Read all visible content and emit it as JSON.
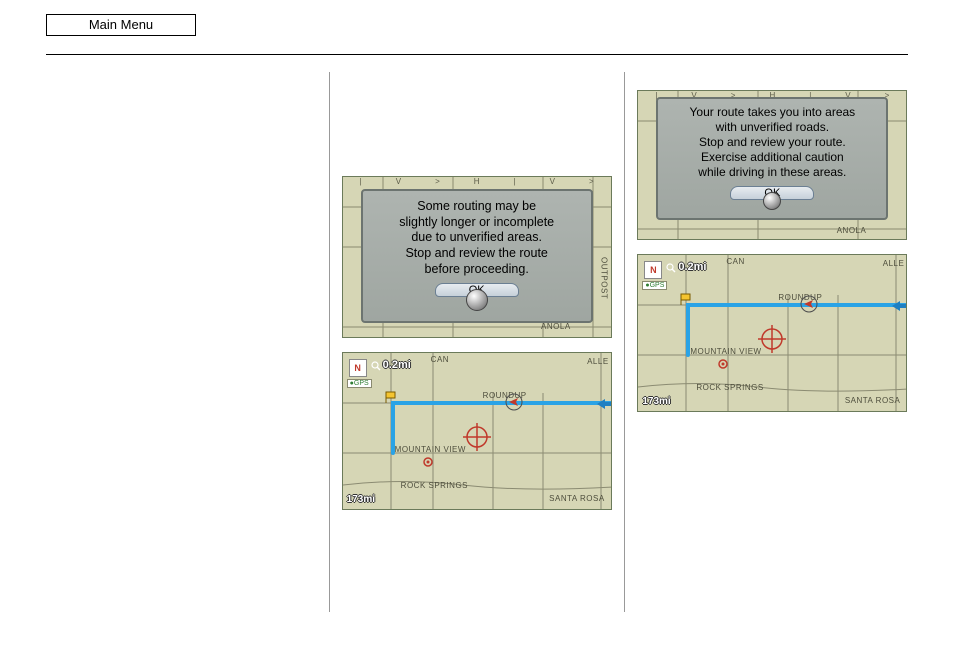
{
  "header": {
    "main_menu": "Main Menu"
  },
  "screens": {
    "caution_off": {
      "lines": [
        "Some routing may be",
        "slightly longer or incomplete",
        "due to unverified areas.",
        "Stop and review the route",
        "before proceeding."
      ],
      "ok": "OK"
    },
    "caution_on": {
      "lines": [
        "Your route takes you into areas",
        "with unverified roads.",
        "Stop and review your route.",
        "Exercise additional caution",
        "while driving in these areas."
      ],
      "ok": "OK"
    },
    "map": {
      "compass": "N",
      "gps": "GPS",
      "scale": "0.2mi",
      "odometer": "173mi",
      "labels": {
        "mountain_view": "MOUNTAIN VIEW",
        "rock_springs": "ROCK SPRINGS",
        "santa_rosa": "SANTA ROSA",
        "roundup": "ROUNDUP",
        "anola": "ANOLA",
        "alle": "ALLE",
        "can": "CAN",
        "outpost": "OUTPOST"
      }
    }
  }
}
